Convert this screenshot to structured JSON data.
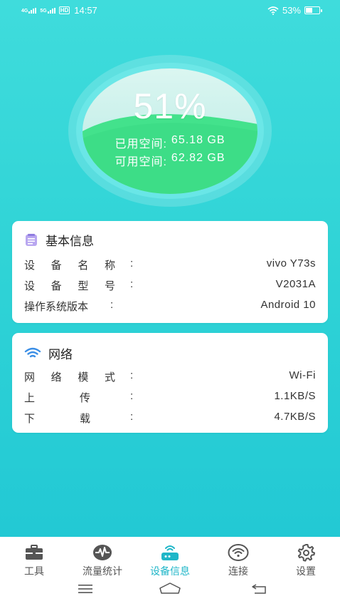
{
  "status_bar": {
    "net1": "4G",
    "net2": "5G",
    "hd": "HD",
    "time": "14:57",
    "battery": "53%",
    "battery_level": 0.53
  },
  "storage": {
    "percent": "51%",
    "used_label": "已用空间:",
    "used_value": "65.18 GB",
    "free_label": "可用空间:",
    "free_value": "62.82 GB",
    "fill_fraction": 0.51
  },
  "basic_info": {
    "title": "基本信息",
    "rows": [
      {
        "label_chars": [
          "设",
          "备",
          "名",
          "称"
        ],
        "colon": ":",
        "value": "vivo Y73s"
      },
      {
        "label_chars": [
          "设",
          "备",
          "型",
          "号"
        ],
        "colon": ":",
        "value": "V2031A"
      },
      {
        "label": "操作系统版本",
        "colon": ":",
        "value": "Android 10"
      }
    ]
  },
  "network": {
    "title": "网络",
    "rows": [
      {
        "label_chars": [
          "网",
          "络",
          "模",
          "式"
        ],
        "colon": ":",
        "value": "Wi-Fi"
      },
      {
        "label_chars": [
          "上",
          "传"
        ],
        "colon": ":",
        "value": "1.1KB/S"
      },
      {
        "label_chars": [
          "下",
          "载"
        ],
        "colon": ":",
        "value": "4.7KB/S"
      }
    ]
  },
  "bottom_nav": {
    "items": [
      {
        "label": "工具",
        "icon": "toolbox-icon"
      },
      {
        "label": "流量统计",
        "icon": "pulse-icon"
      },
      {
        "label": "设备信息",
        "icon": "router-icon",
        "active": true
      },
      {
        "label": "连接",
        "icon": "wifi-circle-icon"
      },
      {
        "label": "设置",
        "icon": "gear-icon"
      }
    ]
  },
  "colors": {
    "background": "#2fd3d6",
    "accent": "#1fb6c8",
    "gauge_green": "#3fe08a"
  }
}
